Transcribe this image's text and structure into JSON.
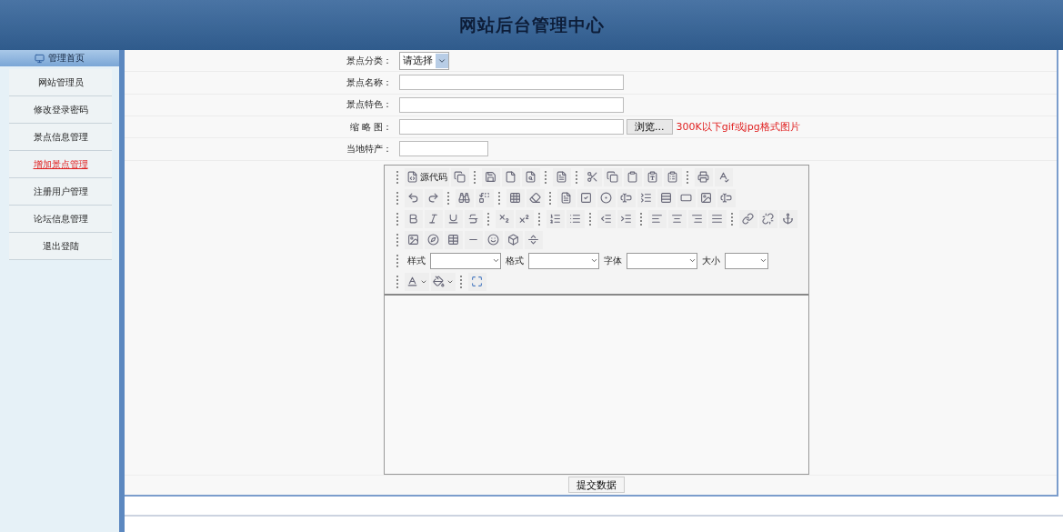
{
  "header": {
    "title": "网站后台管理中心"
  },
  "sidebar": {
    "title": "管理首页",
    "items": [
      {
        "label": "网站管理员",
        "selected": false
      },
      {
        "label": "修改登录密码",
        "selected": false
      },
      {
        "label": "景点信息管理",
        "selected": false
      },
      {
        "label": "增加景点管理",
        "selected": true
      },
      {
        "label": "注册用户管理",
        "selected": false
      },
      {
        "label": "论坛信息管理",
        "selected": false
      },
      {
        "label": "退出登陆",
        "selected": false
      }
    ]
  },
  "form": {
    "rows": [
      {
        "label": "景点分类：",
        "kind": "select",
        "value": "请选择"
      },
      {
        "label": "景点名称：",
        "kind": "text"
      },
      {
        "label": "景点特色：",
        "kind": "text"
      },
      {
        "label": "缩 略 图：",
        "kind": "file",
        "button": "浏览...",
        "hint": "300K以下gif或jpg格式图片"
      },
      {
        "label": "当地特产：",
        "kind": "short"
      }
    ]
  },
  "editor": {
    "source_label": "源代码",
    "dropdowns": [
      "样式",
      "格式",
      "字体",
      "大小"
    ]
  },
  "submit": "提交数据"
}
